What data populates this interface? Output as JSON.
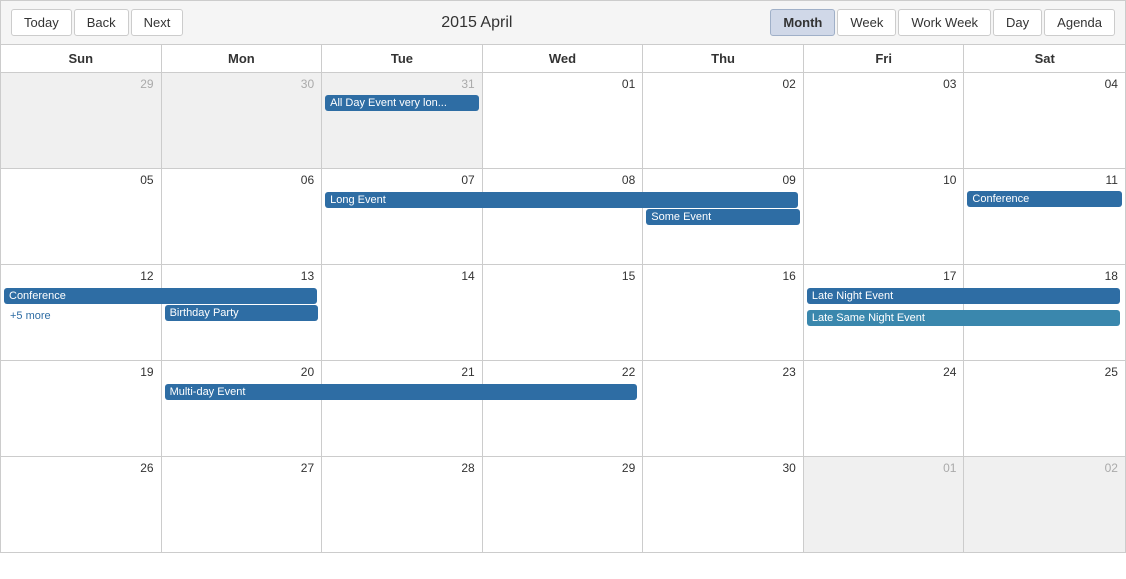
{
  "toolbar": {
    "today_label": "Today",
    "back_label": "Back",
    "next_label": "Next",
    "title": "2015 April",
    "month_label": "Month",
    "week_label": "Week",
    "work_week_label": "Work Week",
    "day_label": "Day",
    "agenda_label": "Agenda"
  },
  "header_days": [
    "Sun",
    "Mon",
    "Tue",
    "Wed",
    "Thu",
    "Fri",
    "Sat"
  ],
  "weeks": [
    {
      "days": [
        {
          "num": "29",
          "other": true
        },
        {
          "num": "30",
          "other": true
        },
        {
          "num": "31",
          "other": true,
          "events": [
            {
              "label": "All Day Event very lon...",
              "color": "blue",
              "span": 1
            }
          ]
        },
        {
          "num": "01"
        },
        {
          "num": "02"
        },
        {
          "num": "03"
        },
        {
          "num": "04"
        }
      ]
    },
    {
      "days": [
        {
          "num": "05"
        },
        {
          "num": "06"
        },
        {
          "num": "07",
          "events": [
            {
              "label": "Long Event",
              "color": "blue",
              "span": 3
            }
          ]
        },
        {
          "num": "08"
        },
        {
          "num": "09",
          "events": [
            {
              "label": "Some Event",
              "color": "blue",
              "span": 1
            }
          ]
        },
        {
          "num": "10"
        },
        {
          "num": "11",
          "events": [
            {
              "label": "Conference",
              "color": "blue",
              "span": 1
            }
          ]
        }
      ]
    },
    {
      "days": [
        {
          "num": "12",
          "events": [
            {
              "label": "Conference",
              "color": "blue",
              "span": 1
            },
            {
              "label": "+5 more",
              "color": "link"
            }
          ]
        },
        {
          "num": "13",
          "events": [
            {
              "label": "Birthday Party",
              "color": "blue",
              "span": 1
            }
          ]
        },
        {
          "num": "14"
        },
        {
          "num": "15"
        },
        {
          "num": "16"
        },
        {
          "num": "17",
          "events": [
            {
              "label": "Late Night Event",
              "color": "blue",
              "span": 2
            },
            {
              "label": "Late Same Night Event",
              "color": "teal",
              "span": 1
            }
          ]
        },
        {
          "num": "18"
        }
      ]
    },
    {
      "days": [
        {
          "num": "19"
        },
        {
          "num": "20",
          "events": [
            {
              "label": "Multi-day Event",
              "color": "blue",
              "span": 3
            }
          ]
        },
        {
          "num": "21"
        },
        {
          "num": "22"
        },
        {
          "num": "23"
        },
        {
          "num": "24"
        },
        {
          "num": "25"
        }
      ]
    },
    {
      "days": [
        {
          "num": "26"
        },
        {
          "num": "27"
        },
        {
          "num": "28"
        },
        {
          "num": "29"
        },
        {
          "num": "30"
        },
        {
          "num": "01",
          "other": true
        },
        {
          "num": "02",
          "other": true
        }
      ]
    }
  ]
}
